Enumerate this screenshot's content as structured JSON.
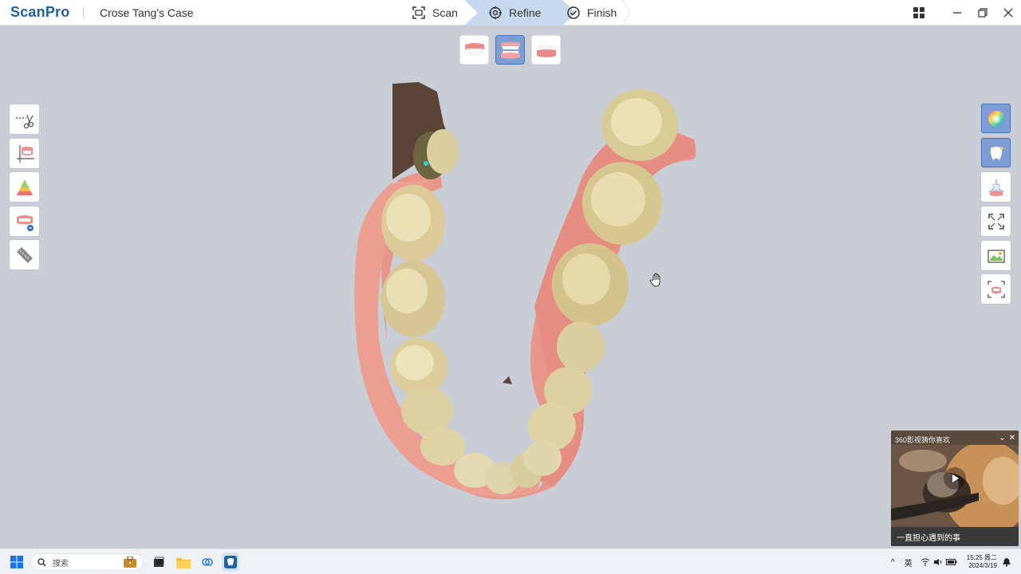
{
  "app": {
    "logo": "ScanPro",
    "case_title": "Crose Tang's Case"
  },
  "steps": [
    {
      "label": "Scan",
      "icon": "scan-icon",
      "active": false
    },
    {
      "label": "Refine",
      "icon": "gear-icon",
      "active": true
    },
    {
      "label": "Finish",
      "icon": "check-circle-icon",
      "active": false
    }
  ],
  "window_controls": [
    "apps-grid-icon",
    "minimize-icon",
    "restore-icon",
    "close-icon"
  ],
  "view_selector": [
    {
      "name": "upper-jaw-view",
      "active": false
    },
    {
      "name": "both-jaws-view",
      "active": true
    },
    {
      "name": "lower-jaw-view",
      "active": false
    }
  ],
  "left_tools": [
    "trim-scissors-tool",
    "base-plane-tool",
    "margin-color-tool",
    "undercut-tool",
    "measure-ruler-tool"
  ],
  "right_tools": [
    {
      "name": "color-texture-tool",
      "active": true
    },
    {
      "name": "lighting-tool",
      "active": true
    },
    {
      "name": "axis-view-tool",
      "active": false
    },
    {
      "name": "fit-screen-tool",
      "active": false
    },
    {
      "name": "screenshot-tool",
      "active": false
    },
    {
      "name": "occlusion-view-tool",
      "active": false
    }
  ],
  "popup": {
    "title": "360影视猜你喜欢",
    "caption": "一直担心遇到的事"
  },
  "taskbar": {
    "search_placeholder": "搜索",
    "ime": "英",
    "time": "15:25 周二",
    "date": "2024/3/19"
  },
  "colors": {
    "brand": "#1f5fa8",
    "active_step": "#c7d9ee",
    "active_tool": "#7d9ed4",
    "viewport_bg": "#c9ced6"
  }
}
